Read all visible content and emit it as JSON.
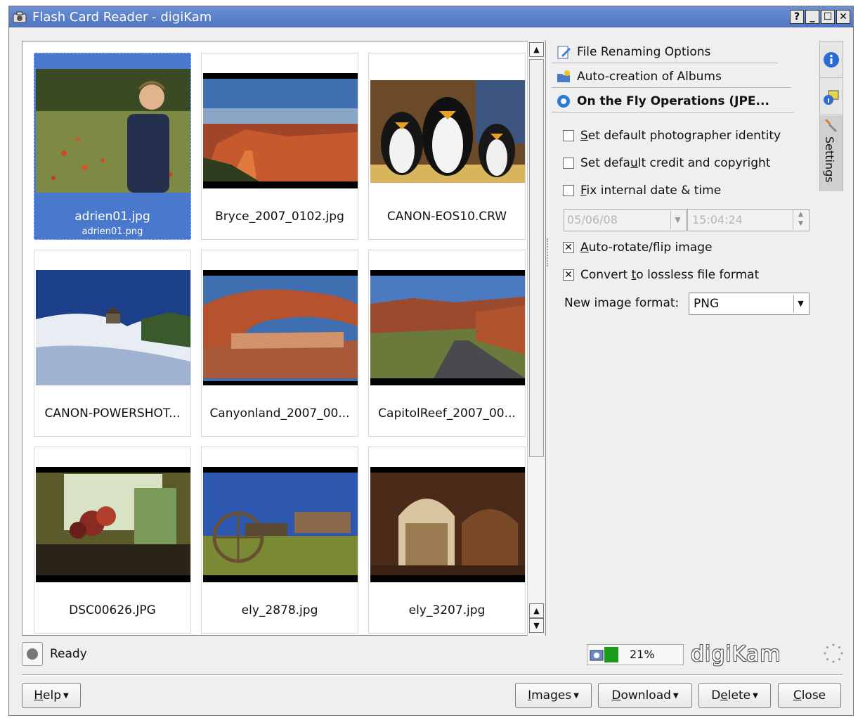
{
  "window": {
    "title": "Flash Card Reader - digiKam",
    "buttons": [
      "?",
      "_",
      "☐",
      "✕"
    ]
  },
  "thumbnails": [
    {
      "name": "adrien01.jpg",
      "sub": "adrien01.png",
      "selected": true,
      "scene": "boy-field"
    },
    {
      "name": "Bryce_2007_0102.jpg",
      "sub": "",
      "selected": false,
      "scene": "canyon"
    },
    {
      "name": "CANON-EOS10.CRW",
      "sub": "",
      "selected": false,
      "scene": "penguins"
    },
    {
      "name": "CANON-POWERSHOT...",
      "sub": "",
      "selected": false,
      "scene": "snow"
    },
    {
      "name": "Canyonland_2007_00...",
      "sub": "",
      "selected": false,
      "scene": "arch"
    },
    {
      "name": "CapitolReef_2007_00...",
      "sub": "",
      "selected": false,
      "scene": "road"
    },
    {
      "name": "DSC00626.JPG",
      "sub": "",
      "selected": false,
      "scene": "flowers"
    },
    {
      "name": "ely_2878.jpg",
      "sub": "",
      "selected": false,
      "scene": "wagon"
    },
    {
      "name": "ely_3207.jpg",
      "sub": "",
      "selected": false,
      "scene": "arcade"
    }
  ],
  "panel": {
    "tabs": [
      {
        "label": "File Renaming Options",
        "icon": "rename-icon"
      },
      {
        "label": "Auto-creation of Albums",
        "icon": "album-icon"
      },
      {
        "label": "On the Fly Operations (JPE...",
        "icon": "operations-icon"
      }
    ],
    "side_tabs": {
      "settings_label": "Settings"
    },
    "options": {
      "photographer": {
        "pre": "",
        "u": "S",
        "post": "et default photographer identity",
        "checked": false
      },
      "credit": {
        "pre": "Set defa",
        "u": "u",
        "post": "lt credit and copyright",
        "checked": false
      },
      "fixdate": {
        "pre": "",
        "u": "F",
        "post": "ix internal date & time",
        "checked": false
      },
      "autorotate": {
        "pre": "",
        "u": "A",
        "post": "uto-rotate/flip image",
        "checked": true
      },
      "lossless": {
        "pre": "Convert ",
        "u": "t",
        "post": "o lossless file format",
        "checked": true
      }
    },
    "date_value": "05/06/08",
    "time_value": "15:04:24",
    "format_label": "New image format:",
    "format_value": "PNG"
  },
  "status": {
    "text": "Ready",
    "progress_text": "21%",
    "progress_value": 0.21,
    "brand": "digiKam"
  },
  "buttons": {
    "help": {
      "pre": "",
      "u": "H",
      "post": "elp"
    },
    "images": {
      "pre": "",
      "u": "I",
      "post": "mages"
    },
    "download": {
      "pre": "",
      "u": "D",
      "post": "ownload"
    },
    "delete": {
      "pre": "D",
      "u": "e",
      "post": "lete"
    },
    "close": {
      "pre": "",
      "u": "C",
      "post": "lose"
    }
  },
  "colors": {
    "title_bar": "#5379c6",
    "selection": "#4a78cd",
    "progress": "#1a9b1a"
  }
}
